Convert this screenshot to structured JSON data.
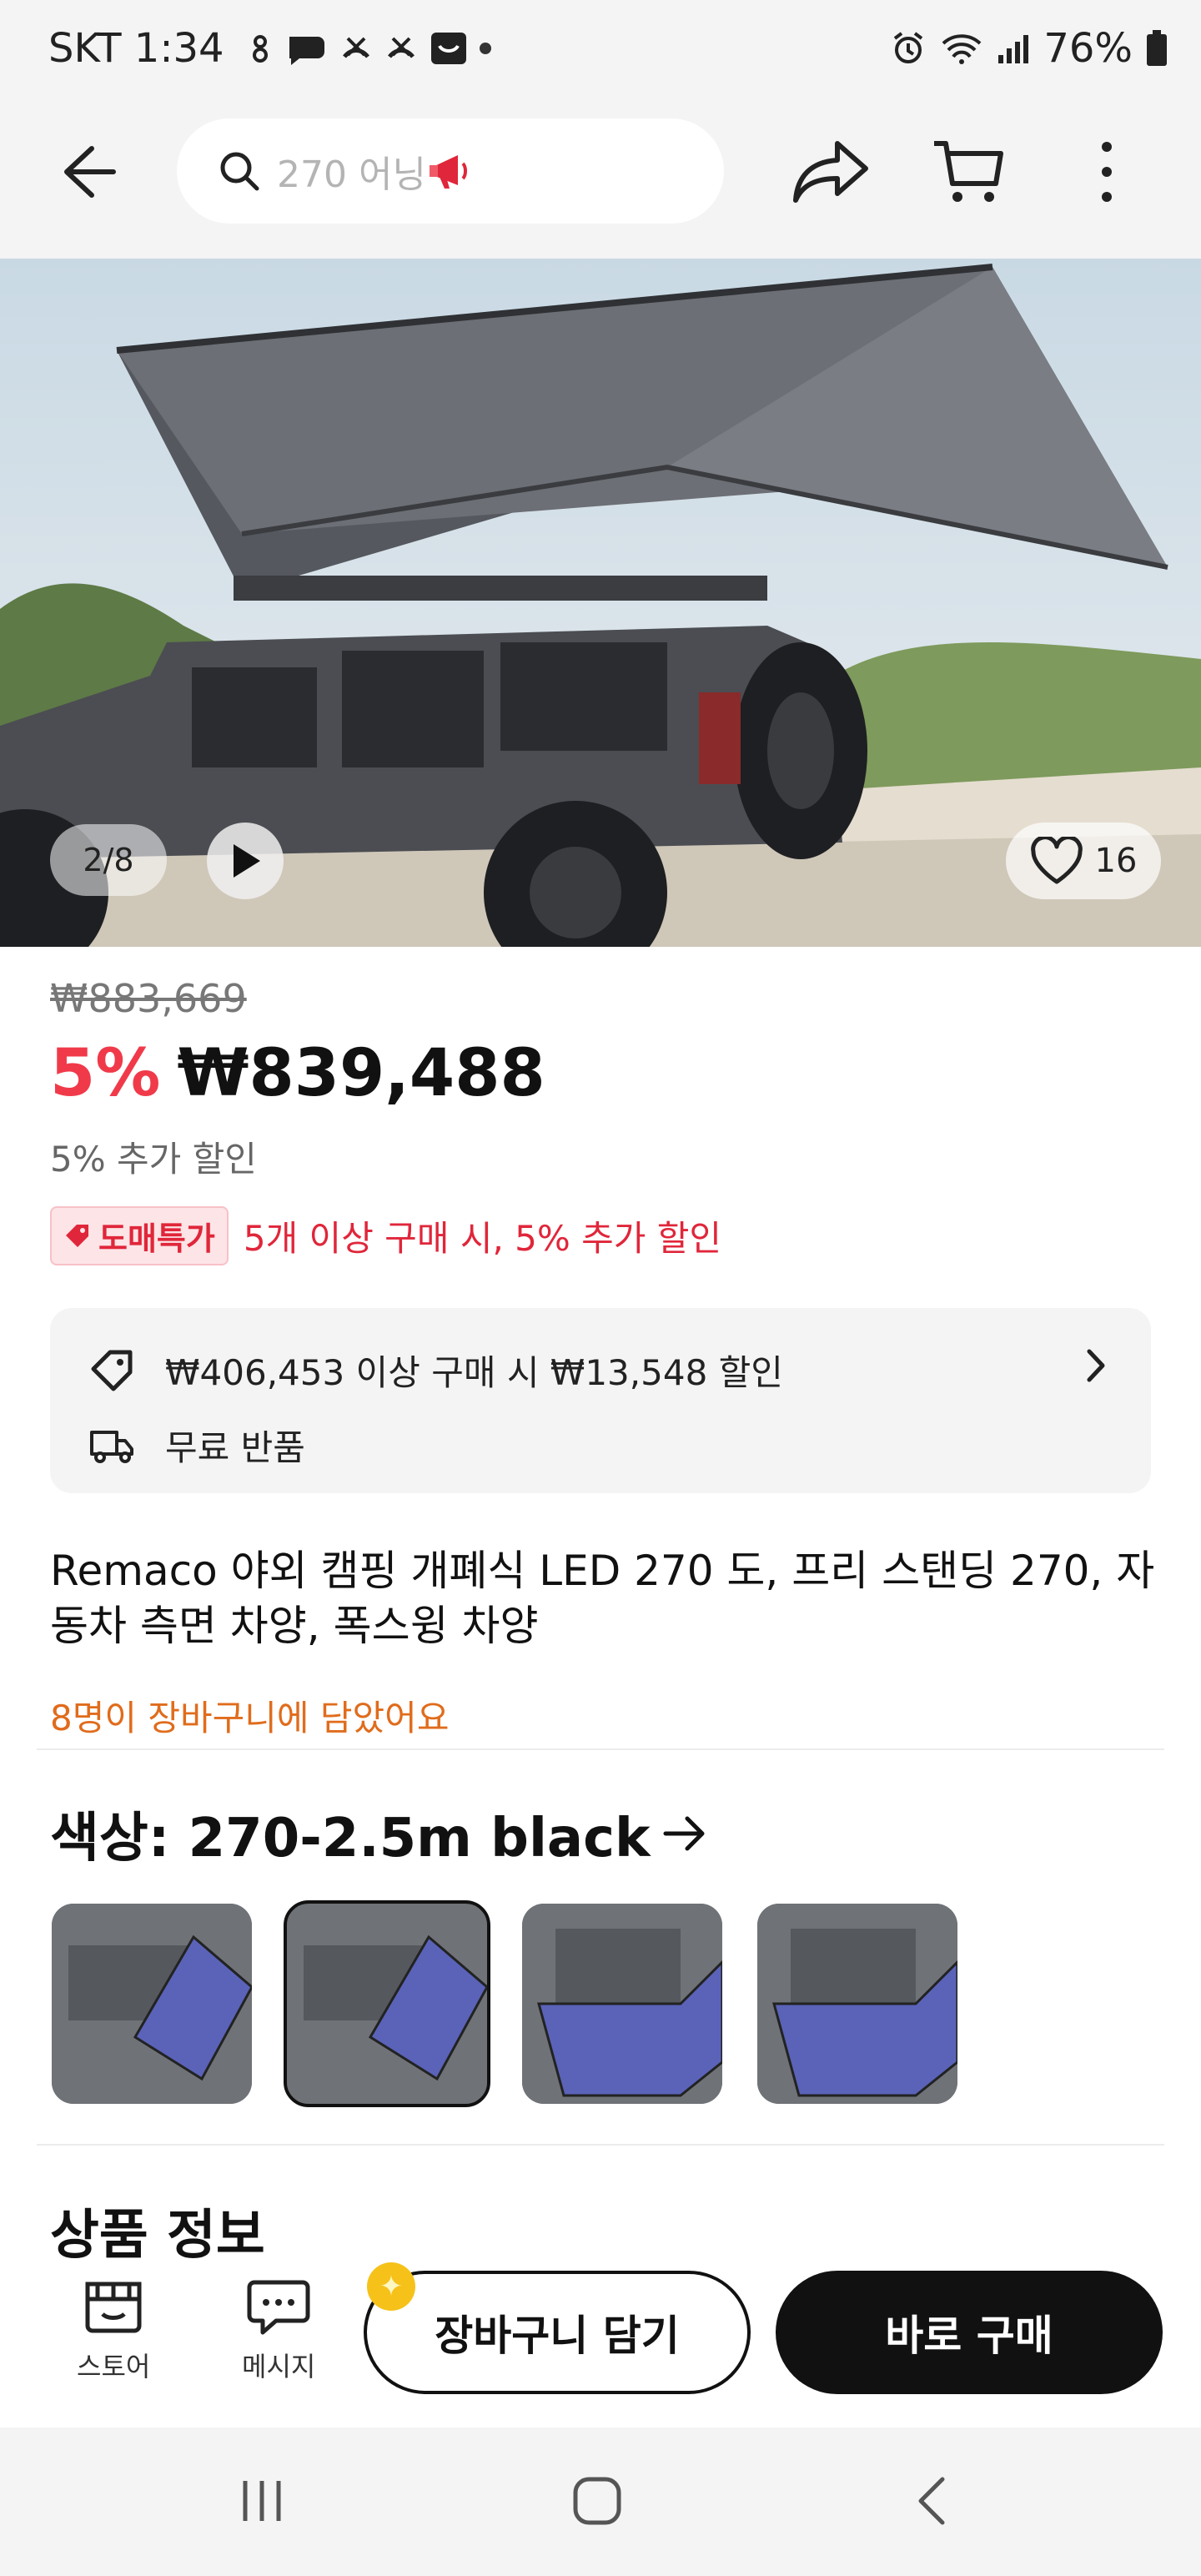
{
  "status_bar": {
    "carrier_time": "SKT 1:34",
    "battery": "76%"
  },
  "search": {
    "placeholder": "270 어닝"
  },
  "gallery": {
    "counter": "2/8",
    "likes": "16"
  },
  "pricing": {
    "original_price": "₩883,669",
    "discount_percent": "5%",
    "sale_price": "₩839,488",
    "extra_discount": "5% 추가 할인",
    "wholesale_badge": "도매특가",
    "wholesale_text": "5개 이상 구매 시, 5% 추가 할인"
  },
  "benefits": {
    "coupon_text": "₩406,453 이상 구매 시 ₩13,548 할인",
    "return_text": "무료 반품"
  },
  "product": {
    "title": "Remaco 야외 캠핑 개폐식 LED 270 도, 프리 스탠딩 270, 자동차 측면 차양, 폭스윙 차양",
    "cart_count_text": "8명이 장바구니에 담았어요",
    "color_label": "색상: 270-2.5m black",
    "section_peek": "상품 정보"
  },
  "bottom_bar": {
    "store_label": "스토어",
    "message_label": "메시지",
    "add_to_cart": "장바구니 담기",
    "buy_now": "바로 구매"
  },
  "colors": {
    "accent_red": "#f03a4a",
    "cart_orange": "#e06c1c",
    "awning_blue": "#5a63b8"
  }
}
